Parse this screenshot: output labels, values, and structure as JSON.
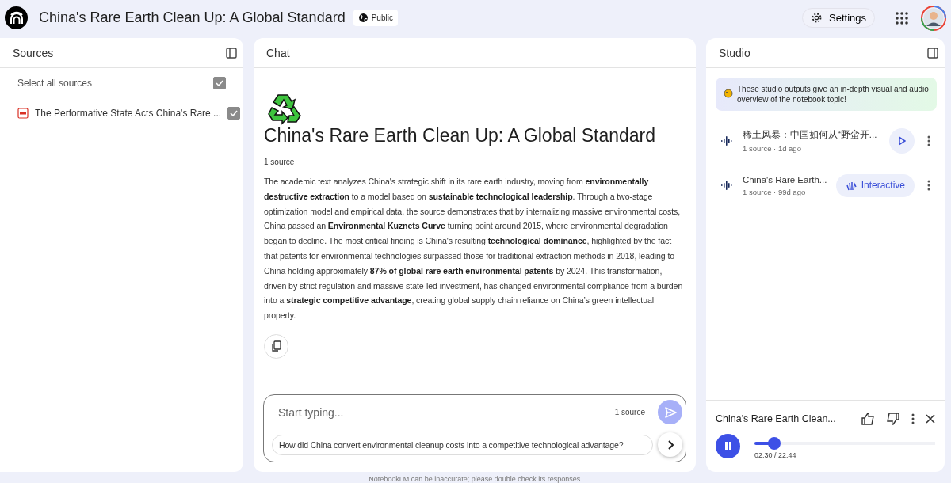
{
  "header": {
    "title": "China's Rare Earth Clean Up: A Global Standard",
    "visibility": "Public",
    "settings": "Settings"
  },
  "sources": {
    "title": "Sources",
    "select_all": {
      "label": "Select all sources",
      "checked": true
    },
    "items": [
      {
        "label": "The Performative State Acts China's Rare ...",
        "checked": true
      }
    ]
  },
  "chat": {
    "title": "Chat",
    "notebook_title": "China's Rare Earth Clean Up: A Global Standard",
    "source_count": "1 source",
    "summary": "The academic text analyzes China's strategic shift in its rare earth industry, moving from **environmentally destructive extraction** to a model based on **sustainable technological leadership**. Through a two-stage optimization model and empirical data, the source demonstrates that by internalizing massive environmental costs, China passed an **Environmental Kuznets Curve** turning point around 2015, where environmental degradation began to decline. The most critical finding is China's resulting **technological dominance**, highlighted by the fact that patents for environmental technologies surpassed those for traditional extraction methods in 2018, leading to China holding approximately **87% of global rare earth environmental patents** by 2024. This transformation, driven by strict regulation and massive state-led investment, has changed environmental compliance from a burden into a **strategic competitive advantage**, creating global supply chain reliance on China’s green intellectual property.",
    "input": {
      "placeholder": "Start typing...",
      "source_count": "1 source"
    },
    "suggestion": "How did China convert environmental cleanup costs into a competitive technological advantage?",
    "disclaimer": "NotebookLM can be inaccurate; please double check its responses."
  },
  "studio": {
    "title": "Studio",
    "banner": "These studio outputs give an in-depth visual and audio overview of the notebook topic!",
    "items": [
      {
        "kind": "audio",
        "title": "稀土风暴：中国如何从“野蛮开...",
        "meta": "1 source · 1d ago"
      },
      {
        "kind": "interactive",
        "title": "China's Rare Earth...",
        "meta": "1 source · 99d ago",
        "action": "Interactive"
      }
    ],
    "player": {
      "title": "China's Rare Earth Clean...",
      "playing": true,
      "level": 0.11,
      "time": "02:30 / 22:44"
    }
  }
}
